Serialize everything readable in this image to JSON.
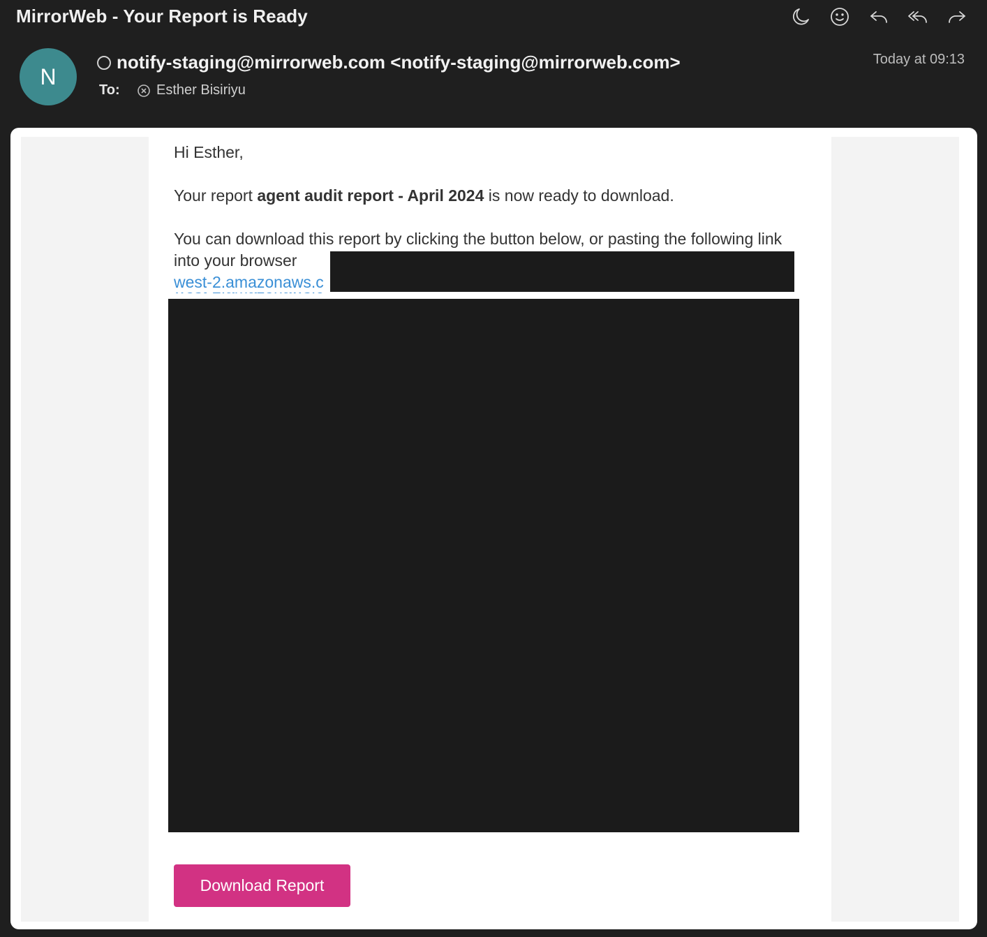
{
  "email": {
    "subject": "MirrorWeb - Your Report is Ready",
    "sender_initial": "N",
    "from": "notify-staging@mirrorweb.com <notify-staging@mirrorweb.com>",
    "to_label": "To:",
    "recipient": "Esther Bisiriyu",
    "date": "Today at 09:13"
  },
  "toolbar": {
    "icons": [
      "moon-icon",
      "smiley-icon",
      "reply-icon",
      "reply-all-icon",
      "forward-icon"
    ]
  },
  "body": {
    "greeting": "Hi Esther,",
    "line1_prefix": "Your report ",
    "report_name": "agent audit report - April 2024",
    "line1_suffix": " is now ready to download.",
    "line2": "You can download this report by clicking the button below, or pasting the following link into your browser",
    "link_visible": "west-2.amazonaws.c",
    "download_button": "Download Report"
  },
  "colors": {
    "accent_button": "#d23283",
    "link": "#3a8fd6",
    "avatar": "#3d8a8e",
    "redaction": "#1b1b1b"
  }
}
